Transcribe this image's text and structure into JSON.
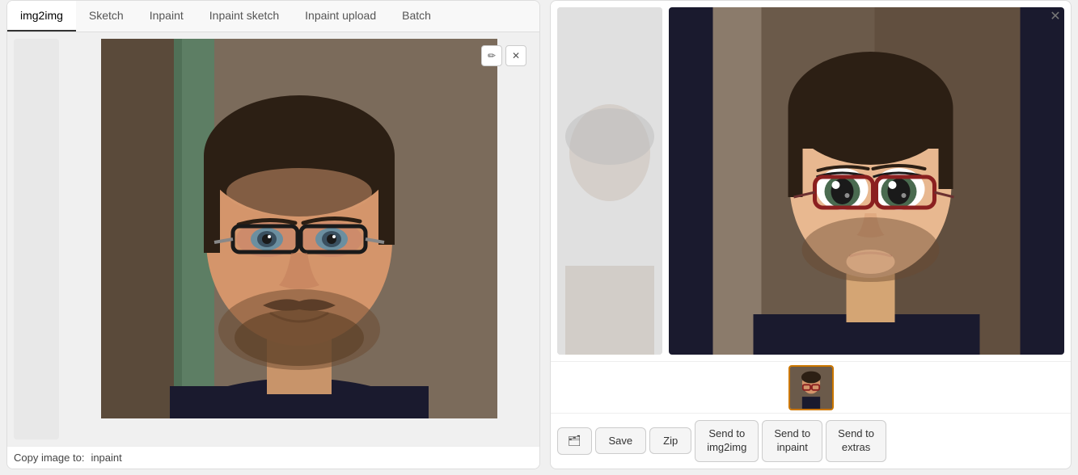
{
  "tabs": {
    "items": [
      {
        "label": "img2img",
        "active": true
      },
      {
        "label": "Sketch",
        "active": false
      },
      {
        "label": "Inpaint",
        "active": false
      },
      {
        "label": "Inpaint sketch",
        "active": false
      },
      {
        "label": "Inpaint upload",
        "active": false
      },
      {
        "label": "Batch",
        "active": false
      }
    ]
  },
  "bottom_bar": {
    "copy_label": "Copy image to:",
    "suffix_label": "inpaint"
  },
  "controls": {
    "edit_icon": "✏",
    "close_icon": "✕"
  },
  "right_panel": {
    "close_icon": "✕"
  },
  "action_buttons": {
    "folder_icon": "🗂",
    "save": "Save",
    "zip": "Zip",
    "send_to_img2img": "Send to\nimg2img",
    "send_to_inpaint": "Send to\ninpaint",
    "send_to_extras": "Send to\nextras"
  }
}
